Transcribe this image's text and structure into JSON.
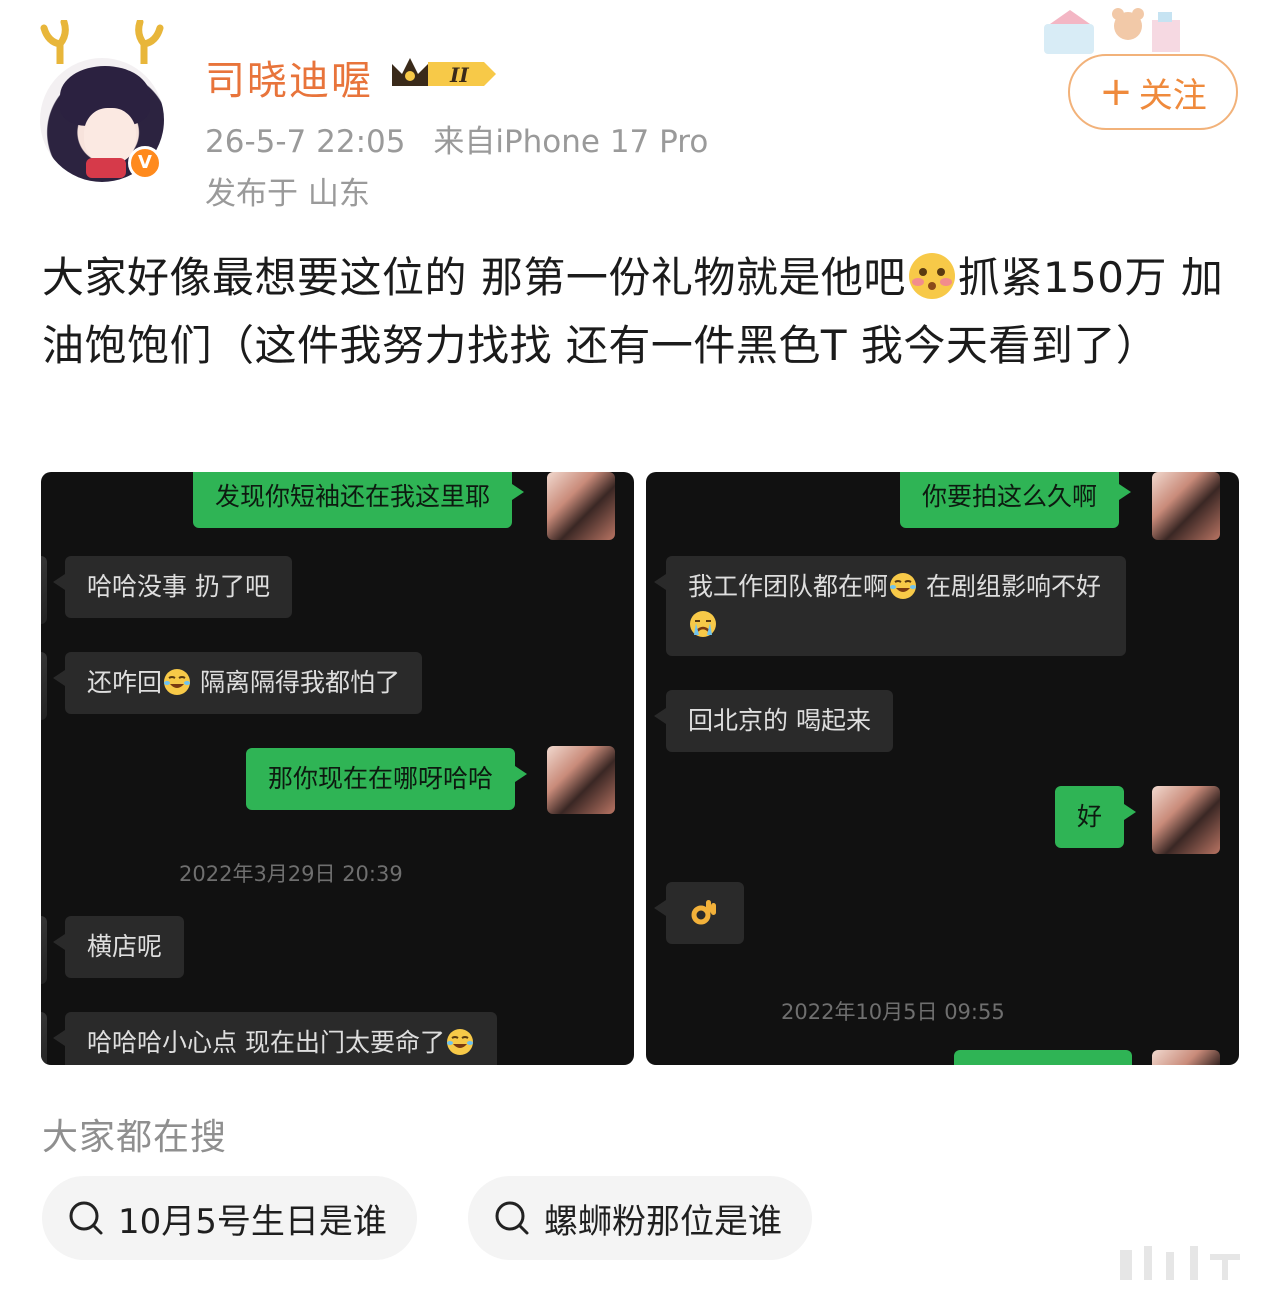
{
  "author": {
    "name": "司晓迪喔",
    "verified_badge": "V",
    "member_level": "II",
    "time": "26-5-7 22:05",
    "source": "来自iPhone 17 Pro",
    "location": "发布于 山东",
    "avatar_icon": "anime-girl-avatar"
  },
  "follow_button": {
    "plus": "+",
    "label": "关注"
  },
  "post": {
    "text_part1": "大家好像最想要这位的 那第一份礼物就是他吧",
    "emoji": "shy-blush-emoji",
    "text_part2": "抓紧150万 加油饱饱们（这件我努力找找 还有一件黑色T 我今天看到了）"
  },
  "left_chat": {
    "messages": [
      {
        "side": "me",
        "text": "发现你短袖还在我这里耶"
      },
      {
        "side": "other",
        "text": "哈哈没事 扔了吧"
      },
      {
        "side": "other",
        "text_a": "还咋回",
        "text_b": "隔离隔得我都怕了"
      },
      {
        "side": "me",
        "text": "那你现在在哪呀哈哈"
      },
      {
        "side": "other",
        "text": "横店呢"
      },
      {
        "side": "other",
        "text": "哈哈哈小心点 现在出门太要命了"
      }
    ],
    "timestamp": "2022年3月29日 20:39"
  },
  "right_chat": {
    "messages": [
      {
        "side": "me",
        "text": "你要拍这么久啊"
      },
      {
        "side": "other",
        "text_a": "我工作团队都在啊",
        "text_b": "在剧组影响不好"
      },
      {
        "side": "other",
        "text": "回北京的 喝起来"
      },
      {
        "side": "me",
        "text": "好"
      },
      {
        "side": "other",
        "text": "👌"
      }
    ],
    "timestamp": "2022年10月5日 09:55"
  },
  "search": {
    "title": "大家都在搜",
    "chips": [
      "10月5号生日是谁",
      "螺蛳粉那位是谁"
    ]
  },
  "colors": {
    "accent": "#e8743b",
    "follow_border": "#f2b27a",
    "chat_green": "#2fb455",
    "chat_gray": "#2a2a2a",
    "chat_bg": "#111111"
  }
}
